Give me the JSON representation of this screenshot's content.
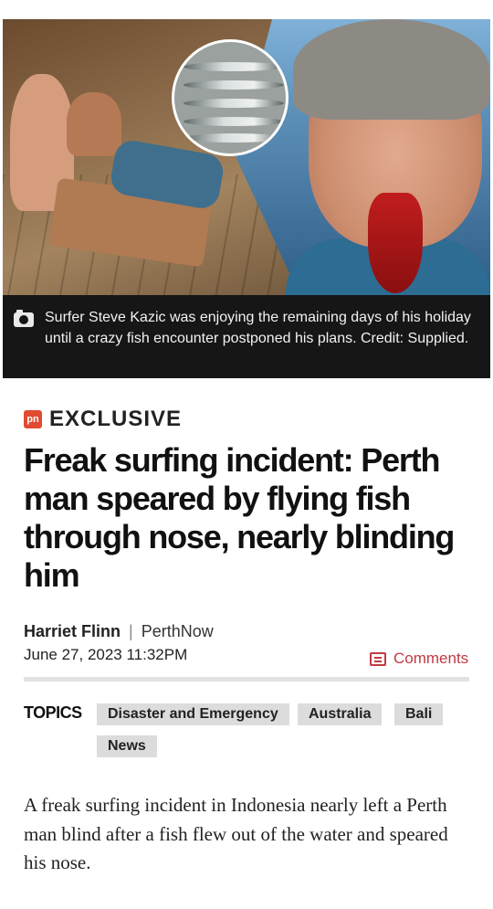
{
  "hero": {
    "caption": "Surfer Steve Kazic was enjoying the remaining days of his holiday until a crazy fish encounter postponed his plans. Credit: Supplied.",
    "caption_icon": "camera-icon"
  },
  "article": {
    "badge_logo": "pn",
    "badge_label": "EXCLUSIVE",
    "headline": "Freak surfing incident: Perth man speared by flying fish through nose, nearly blinding him",
    "author": "Harriet Flinn",
    "outlet": "PerthNow",
    "separator": "|",
    "date": "June 27, 2023 11:32PM",
    "comments_label": "Comments",
    "lead": "A freak surfing incident in Indonesia nearly left a Perth man blind after a fish flew out of the water and speared his nose."
  },
  "topics": {
    "label": "TOPICS",
    "items": [
      "Disaster and Emergency",
      "Australia",
      "Bali",
      "News"
    ]
  },
  "colors": {
    "accent": "#c23a44",
    "logo": "#e14b31",
    "chip_bg": "#dcdcdc",
    "caption_bg": "#161616"
  }
}
